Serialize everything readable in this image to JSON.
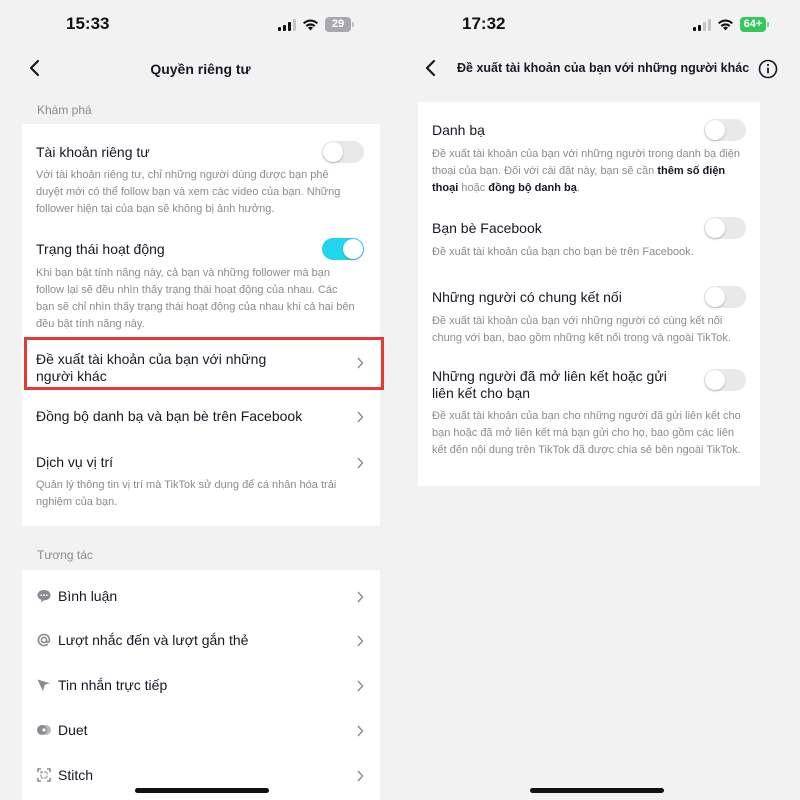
{
  "left": {
    "status": {
      "time": "15:33",
      "battery": "29",
      "battery_color": "#a9a9ad"
    },
    "nav": {
      "title": "Quyền riêng tư"
    },
    "discover": {
      "header": "Khám phá",
      "private_account": {
        "title": "Tài khoản riêng tư",
        "desc": "Với tài khoản riêng tư, chỉ những người dùng được bạn phê duyệt mới có thể follow bạn và xem các video của bạn. Những follower hiện tại của bạn sẽ không bị ảnh hưởng.",
        "enabled": false
      },
      "activity_status": {
        "title": "Trạng thái hoạt động",
        "desc": "Khi bạn bật tính năng này, cả bạn và những follower mà bạn follow lại sẽ đều nhìn thấy trạng thái hoạt động của nhau. Các bạn sẽ chỉ nhìn thấy trạng thái hoạt động của nhau khi cả hai bên đều bật tính năng này.",
        "enabled": true
      },
      "suggest_account": {
        "title": "Đề xuất tài khoản của bạn với những người khác"
      },
      "sync": {
        "title": "Đồng bộ danh bạ và bạn bè trên Facebook"
      },
      "location": {
        "title": "Dịch vụ vị trí",
        "desc": "Quản lý thông tin vị trí mà TikTok sử dụng để cá nhân hóa trải nghiệm của bạn."
      }
    },
    "interaction": {
      "header": "Tương tác",
      "items": [
        {
          "label": "Bình luận",
          "icon": "comment-icon"
        },
        {
          "label": "Lượt nhắc đến và lượt gắn thẻ",
          "icon": "at-sign-icon"
        },
        {
          "label": "Tin nhắn trực tiếp",
          "icon": "send-icon"
        },
        {
          "label": "Duet",
          "icon": "duet-icon"
        },
        {
          "label": "Stitch",
          "icon": "stitch-icon"
        }
      ]
    },
    "highlight_color": "#e53935"
  },
  "right": {
    "status": {
      "time": "17:32",
      "battery": "64+",
      "battery_color": "#34c759"
    },
    "nav": {
      "title": "Đề xuất tài khoản của bạn với những người khác"
    },
    "items": [
      {
        "title": "Danh bạ",
        "desc_pre": "Đề xuất tài khoản của bạn với những người trong danh bạ điện thoại của bạn. Đối với cài đặt này, bạn sẽ cần ",
        "desc_link1": "thêm số điện thoại",
        "desc_mid": " hoặc ",
        "desc_link2": "đồng bộ danh bạ",
        "desc_post": ".",
        "enabled": false
      },
      {
        "title": "Bạn bè Facebook",
        "desc": "Đề xuất tài khoản của bạn cho bạn bè trên Facebook.",
        "enabled": false
      },
      {
        "title": "Những người có chung kết nối",
        "desc": "Đề xuất tài khoản của bạn với những người có cùng kết nối chung với bạn, bao gồm những kết nối trong và ngoài TikTok.",
        "enabled": false
      },
      {
        "title": "Những người đã mở liên kết hoặc gửi liên kết cho bạn",
        "desc": "Đề xuất tài khoản của bạn cho những người đã gửi liên kết cho bạn hoặc đã mở liên kết mà bạn gửi cho họ, bao gồm các liên kết đến nội dung trên TikTok đã được chia sẻ bên ngoài TikTok.",
        "enabled": false
      }
    ]
  },
  "colors": {
    "toggle_on": "#20d5ec",
    "toggle_off": "#e9e9ea",
    "text": "#161823",
    "muted": "#8a8b91"
  }
}
